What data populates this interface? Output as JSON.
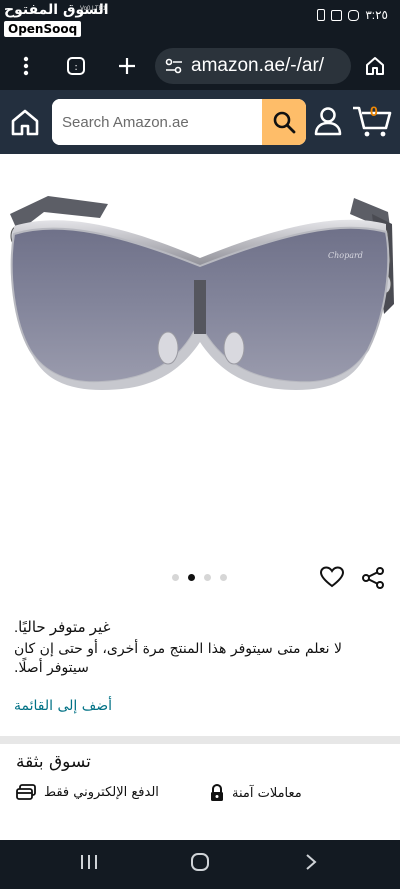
{
  "status_bar": {
    "brand": "السوق المفتوح",
    "badge": "OpenSooq",
    "network": "Vo0 LTE1",
    "time": "٣:٢٥"
  },
  "browser": {
    "url": "amazon.ae/-/ar/",
    "tab_count": ":"
  },
  "header": {
    "search_placeholder": "Search Amazon.ae",
    "cart_count": "0"
  },
  "gallery": {
    "dots": 4,
    "active_dot": 1
  },
  "availability": {
    "title": "غير متوفر حاليًا.",
    "message": "لا نعلم متى سيتوفر هذا المنتج مرة أخرى، أو حتى إن كان سيتوفر أصلًا.",
    "add_to_list": "أضف إلى القائمة"
  },
  "shop_safe": {
    "title": "تسوق بثقة",
    "secure_transactions": "معاملات آمنة",
    "electronic_payment": "الدفع الإلكتروني فقط"
  },
  "colors": {
    "amazon_header": "#232f3e",
    "search_button": "#febd69",
    "cart_accent": "#f08804",
    "link": "#007185"
  }
}
